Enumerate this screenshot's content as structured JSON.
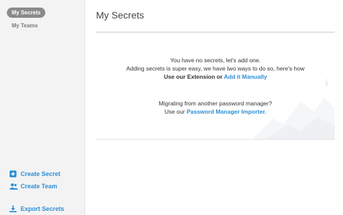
{
  "sidebar": {
    "nav": [
      {
        "label": "My Secrets",
        "active": true
      },
      {
        "label": "My Teams",
        "active": false
      }
    ],
    "actions": [
      {
        "label": "Create Secret",
        "icon": "plus-square-icon"
      },
      {
        "label": "Create Team",
        "icon": "users-icon"
      },
      {
        "label": "Export Secrets",
        "icon": "download-icon"
      }
    ]
  },
  "main": {
    "title": "My Secrets",
    "empty": {
      "line1": "You have no secrets, let's add one.",
      "line2": "Adding secrets is super easy, we have two ways to do so, here's how",
      "line3_prefix": "Use our Extension or ",
      "line3_link": "Add it Manually",
      "line4": "Migrating from another password manager?",
      "line5_prefix": "Use our ",
      "line5_link": "Password Manager Importer."
    }
  },
  "colors": {
    "accent": "#2b8fd6",
    "sidebar_bg": "#f3f3f3",
    "active_pill": "#8a8a8a"
  }
}
